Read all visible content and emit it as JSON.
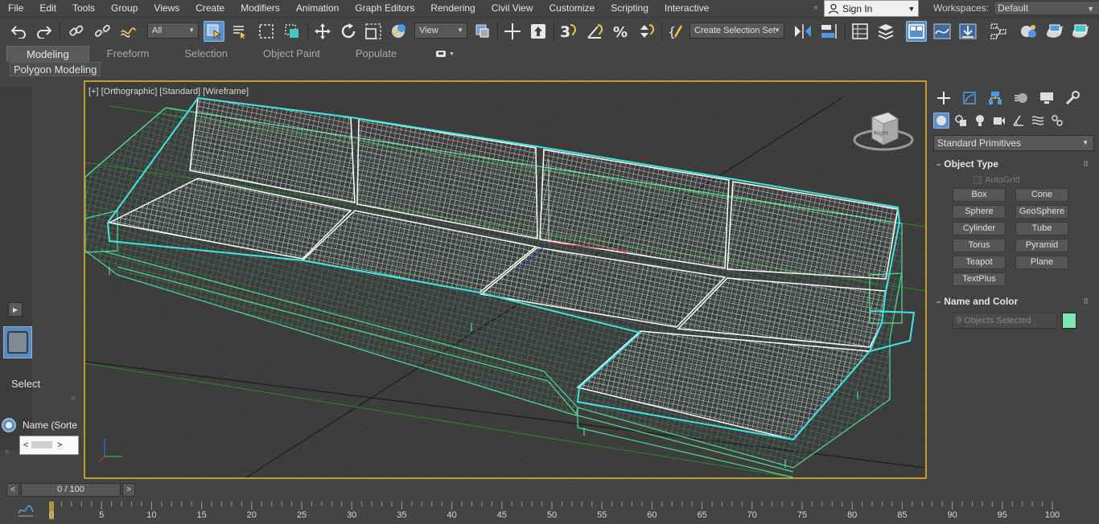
{
  "menu": [
    "File",
    "Edit",
    "Tools",
    "Group",
    "Views",
    "Create",
    "Modifiers",
    "Animation",
    "Graph Editors",
    "Rendering",
    "Civil View",
    "Customize",
    "Scripting",
    "Interactive"
  ],
  "menu_more": "»",
  "signin": {
    "label": "Sign In",
    "icon": "user-icon"
  },
  "workspaces": {
    "label": "Workspaces:",
    "value": "Default"
  },
  "toolbar": {
    "selection_filter": "All",
    "ref_coord": "View",
    "named_selection": "Create Selection Set",
    "icons": [
      "undo-icon",
      "redo-icon",
      "link-icon",
      "unlink-icon",
      "bind-space-warp-icon",
      "select-object-icon",
      "select-by-name-icon",
      "rect-selection-region-icon",
      "window-crossing-icon",
      "move-icon",
      "rotate-icon",
      "scale-icon",
      "place-icon",
      "use-pivot-center-icon",
      "select-manipulate-icon",
      "snap-3d-icon",
      "angle-snap-icon",
      "percent-snap-icon",
      "spinner-snap-icon",
      "edit-named-sets-icon",
      "mirror-icon",
      "align-icon",
      "scene-explorer-icon",
      "layer-explorer-icon",
      "toggle-ribbon-icon",
      "curve-editor-icon",
      "dope-sheet-icon",
      "schematic-view-icon",
      "material-editor-icon",
      "render-setup-icon",
      "rendered-frame-icon",
      "render-production-icon"
    ]
  },
  "ribbon": {
    "tabs": [
      "Modeling",
      "Freeform",
      "Selection",
      "Object Paint",
      "Populate"
    ],
    "active_tab": "Modeling",
    "sub_label": "Polygon Modeling"
  },
  "left_panel": {
    "select_label": "Select",
    "sort_label": "Name (Sorte",
    "chevron": "»",
    "arrow": "▶"
  },
  "viewport": {
    "label": "[+] [Orthographic] [Standard] [Wireframe]",
    "viewcube_face": "Right",
    "border_color": "#c29a2e",
    "wire_green": "#4fdc94",
    "wire_white": "#ffffff",
    "selection_cyan": "#3ee6e6"
  },
  "command_panel": {
    "tabs": [
      "create-icon",
      "modify-icon",
      "hierarchy-icon",
      "motion-icon",
      "display-icon",
      "utilities-icon"
    ],
    "categories": [
      "geometry-icon",
      "shapes-icon",
      "lights-icon",
      "cameras-icon",
      "helpers-icon",
      "space-warps-icon",
      "systems-icon"
    ],
    "dropdown": "Standard Primitives",
    "object_type": {
      "title": "Object Type",
      "autogrid": "AutoGrid",
      "buttons": [
        "Box",
        "Cone",
        "Sphere",
        "GeoSphere",
        "Cylinder",
        "Tube",
        "Torus",
        "Pyramid",
        "Teapot",
        "Plane",
        "TextPlus"
      ]
    },
    "name_color": {
      "title": "Name and Color",
      "field_value": "9 Objects Selected",
      "swatch_color": "#7ee8b4"
    },
    "rollout_symbol": "−",
    "grip": "⠿"
  },
  "time_slider": {
    "value": "0 / 100",
    "prev": "<",
    "next": ">"
  },
  "trackbar": {
    "ticks": [
      "0",
      "5",
      "10",
      "15",
      "20",
      "25",
      "30",
      "35",
      "40",
      "45",
      "50",
      "55",
      "60",
      "65",
      "70",
      "75",
      "80",
      "85",
      "90",
      "95",
      "100"
    ]
  }
}
